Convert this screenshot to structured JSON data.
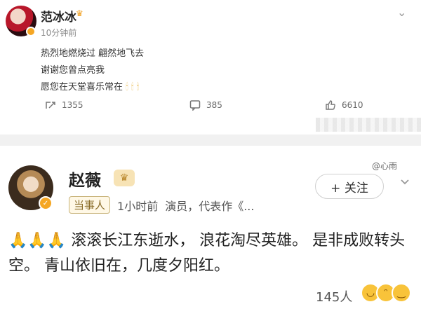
{
  "post1": {
    "author": "范冰冰",
    "time": "10分钟前",
    "lines": [
      "热烈地燃烧过 翩然地飞去",
      "谢谢您曾点亮我",
      "愿您在天堂喜乐常在"
    ],
    "candles": "🕯🕯🕯",
    "actions": {
      "shares": "1355",
      "comments": "385",
      "likes": "6610"
    }
  },
  "post2": {
    "author": "赵薇",
    "tag": "当事人",
    "time": "1小时前",
    "meta": "演员，代表作《...",
    "follow_label": "+ 关注",
    "hands": "🙏🙏🙏",
    "text": "滚滚长江东逝水， 浪花淘尽英雄。 是非成败转头空。 青山依旧在，几度夕阳红。",
    "reaction_count": "145人"
  },
  "watermark": "@心雨",
  "colors": {
    "accent_gold": "#f5a623",
    "divider": "#f1f1f1"
  },
  "icons": [
    "share-icon",
    "comment-icon",
    "like-icon",
    "more-icon",
    "verified-badge-icon",
    "crown-icon"
  ]
}
